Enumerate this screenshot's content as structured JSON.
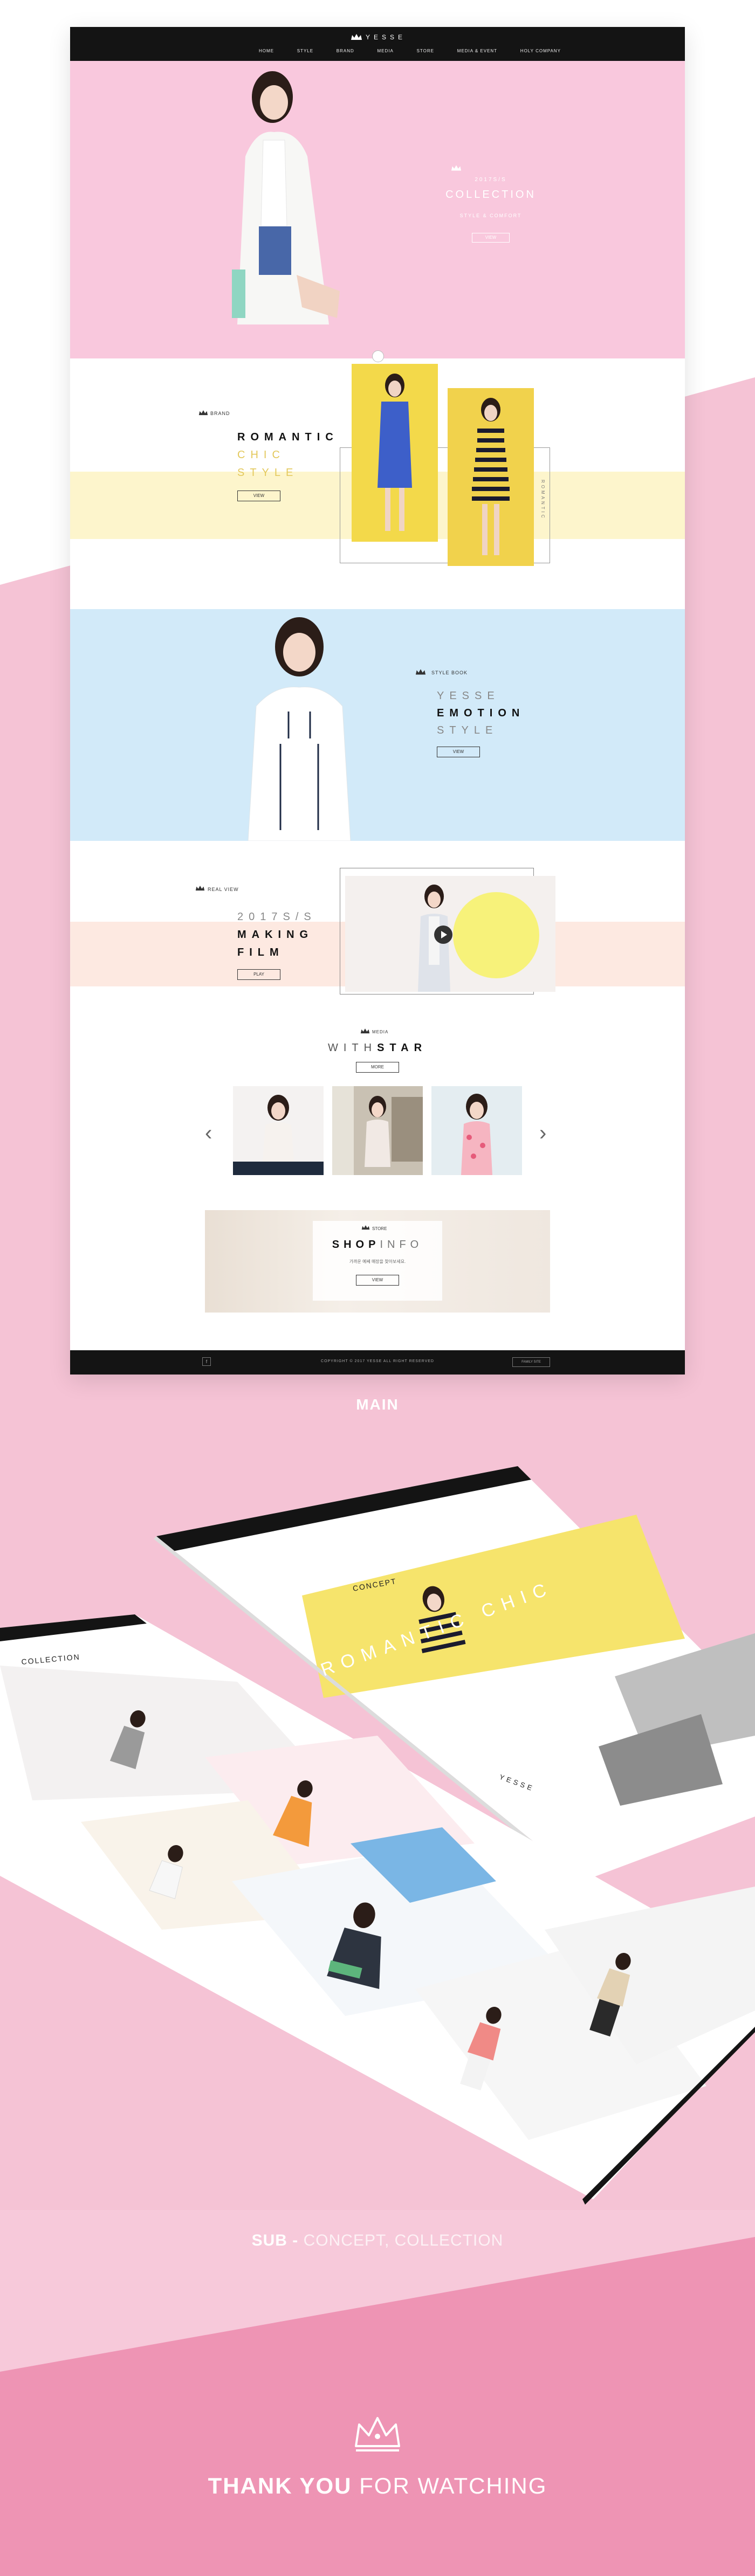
{
  "main_page": {
    "nav": {
      "logo": "YESSE",
      "menu": [
        "HOME",
        "STYLE",
        "BRAND",
        "MEDIA",
        "STORE",
        "MEDIA & EVENT",
        "HOLY COMPANY"
      ]
    },
    "hero": {
      "subtitle": "2017S/S",
      "title": "COLLECTION",
      "description": "STYLE & COMFORT",
      "button": "VIEW"
    },
    "romantic": {
      "tag": "BRAND",
      "line1": "ROMANTIC",
      "line2": "CHIC",
      "line3": "STYLE",
      "button": "VIEW",
      "vertical_text": "ROMANTIC"
    },
    "emotion": {
      "tag": "STYLE BOOK",
      "line1": "YESSE",
      "line2": "EMOTION",
      "line3": "STYLE",
      "button": "VIEW"
    },
    "film": {
      "tag": "REAL VIEW",
      "line1": "2017S/S",
      "line2": "MAKING",
      "line3": "FILM",
      "button": "PLAY"
    },
    "star": {
      "tag": "MEDIA",
      "title_light": "WITH",
      "title_bold": "STAR",
      "button": "MORE"
    },
    "shop": {
      "tag": "STORE",
      "title_bold": "SHOP",
      "title_light": "INFO",
      "description": "가까운 예쎄 매장을 찾아보세요.",
      "button": "VIEW"
    },
    "footer": {
      "copyright": "COPYRIGHT © 2017 YESSE ALL RIGHT RESERVED",
      "button": "FAMILY SITE"
    }
  },
  "labels": {
    "main": "MAIN",
    "sub_bold": "SUB - ",
    "sub_light": "CONCEPT, COLLECTION",
    "thank_bold": "THANK YOU",
    "thank_light": " FOR WATCHING"
  },
  "sub_pages": {
    "concept_title": "CONCEPT",
    "concept_banner": "ROMANTIC CHIC",
    "collection_title": "COLLECTION",
    "brand_logo": "YESSE"
  },
  "colors": {
    "background_pink": "#f5c3d5",
    "hero_pink": "#f9c8dd",
    "yellow": "#f3d94a",
    "sky_blue": "#d2eaf9",
    "nav_black": "#141414"
  }
}
